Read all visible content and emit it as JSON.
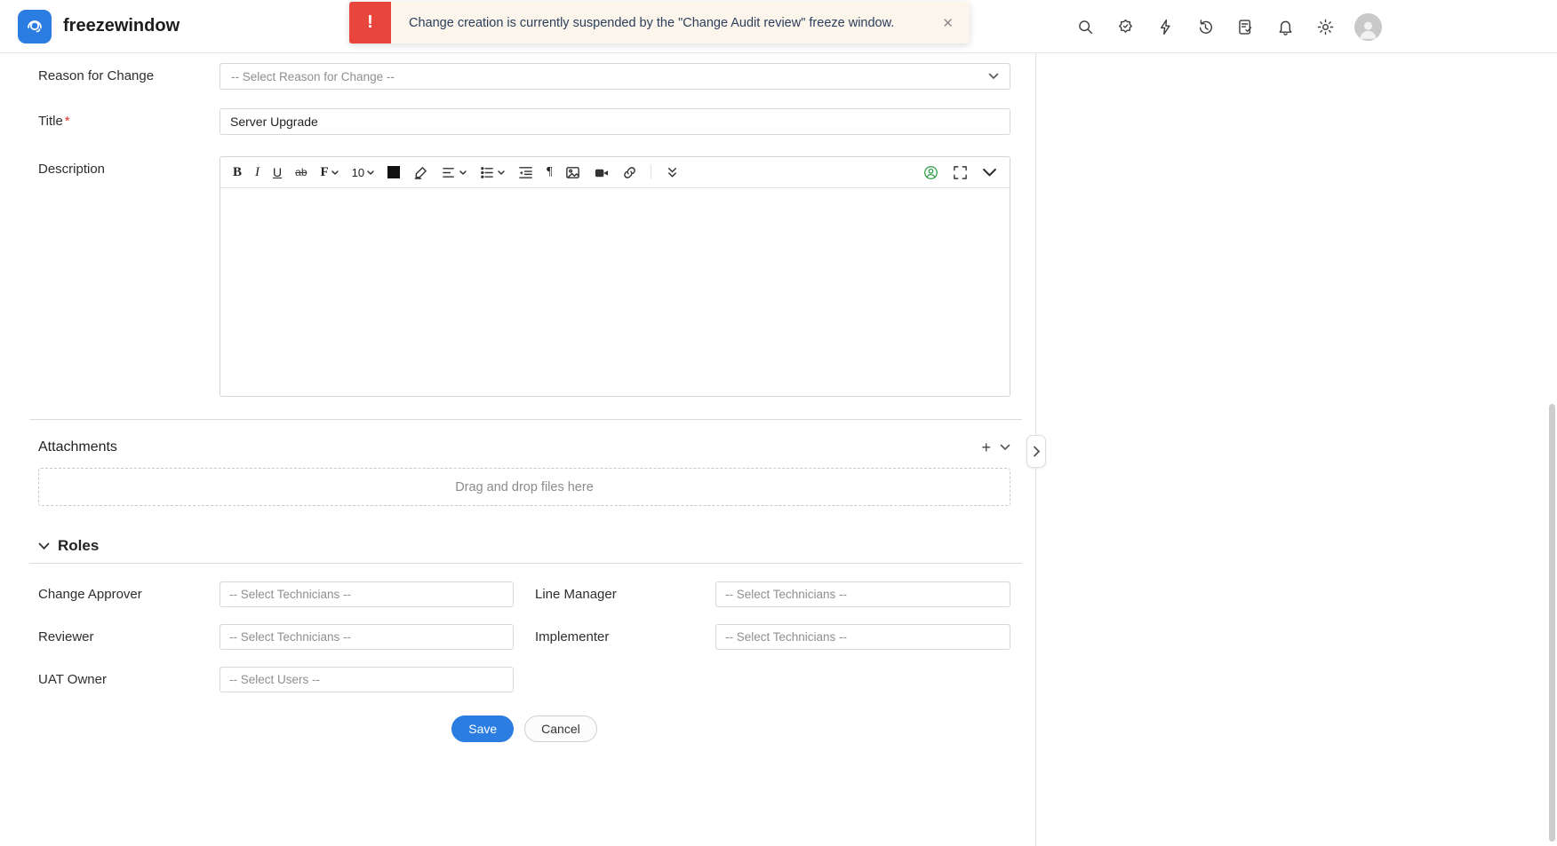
{
  "header": {
    "app_title": "freezewindow",
    "alert": {
      "icon": "!",
      "message": "Change creation is currently suspended by the \"Change Audit review\" freeze window.",
      "close": "✕"
    }
  },
  "form": {
    "reason": {
      "label": "Reason for Change",
      "placeholder": "-- Select Reason for Change --"
    },
    "title": {
      "label": "Title",
      "required": "*",
      "value": "Server Upgrade"
    },
    "description": {
      "label": "Description"
    },
    "editor": {
      "bold": "B",
      "italic": "I",
      "underline": "U",
      "strike": "ab",
      "font": "F",
      "size": "10",
      "direction": "¶"
    },
    "attachments": {
      "label": "Attachments",
      "add": "+",
      "dropzone": "Drag and drop files here"
    },
    "roles": {
      "label": "Roles",
      "fields": [
        {
          "label": "Change Approver",
          "placeholder": "-- Select Technicians --"
        },
        {
          "label": "Line Manager",
          "placeholder": "-- Select Technicians --"
        },
        {
          "label": "Reviewer",
          "placeholder": "-- Select Technicians --"
        },
        {
          "label": "Implementer",
          "placeholder": "-- Select Technicians --"
        },
        {
          "label": "UAT Owner",
          "placeholder": "-- Select Users --"
        }
      ]
    },
    "actions": {
      "save": "Save",
      "cancel": "Cancel"
    }
  },
  "colors": {
    "accent": "#2b7de1",
    "alert_red": "#e8453c",
    "alert_bg": "#fbf5ec"
  }
}
